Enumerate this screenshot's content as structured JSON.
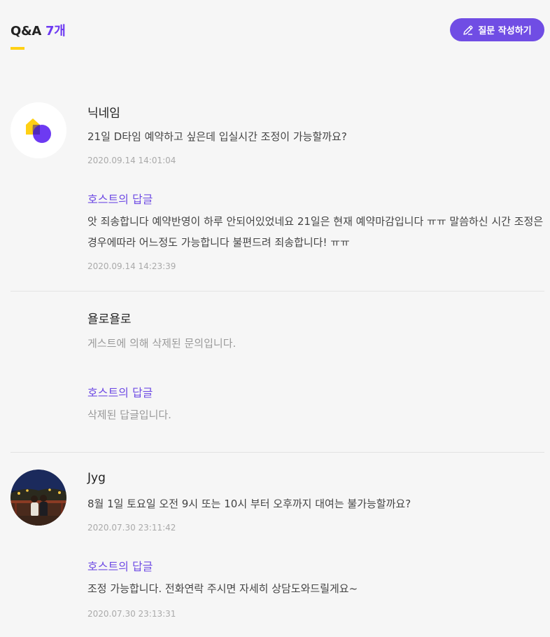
{
  "header": {
    "title": "Q&A",
    "count": "7개",
    "write_button_label": "질문 작성하기"
  },
  "colors": {
    "accent": "#704de4",
    "underline": "#ffd014",
    "background": "#f6f6f6"
  },
  "items": [
    {
      "nickname": "닉네임",
      "avatar_icon": "spacecloud-logo-icon",
      "question": "21일 D타임 예약하고 싶은데 입실시간 조정이 가능할까요?",
      "date": "2020.09.14 14:01:04",
      "host_label": "호스트의 답글",
      "answer": "앗 죄송합니다 예약반영이 하루 안되어있었네요 21일은 현재 예약마감입니다 ㅠㅠ 말씀하신 시간 조정은 경우에따라 어느정도 가능합니다 불편드려 죄송합니다! ㅠㅠ",
      "answer_date": "2020.09.14 14:23:39"
    },
    {
      "nickname": "욜로욜로",
      "question": "게스트에 의해 삭제된 문의입니다.",
      "host_label": "호스트의 답글",
      "answer": "삭제된 답글입니다."
    },
    {
      "nickname": "Jyg",
      "avatar_icon": "user-photo-night-scene",
      "question": "8월 1일 토요일 오전 9시 또는 10시 부터 오후까지 대여는 불가능할까요?",
      "date": "2020.07.30 23:11:42",
      "host_label": "호스트의 답글",
      "answer": "조정 가능합니다. 전화연락 주시면 자세히 상담도와드릴게요~",
      "answer_date": "2020.07.30 23:13:31"
    }
  ]
}
